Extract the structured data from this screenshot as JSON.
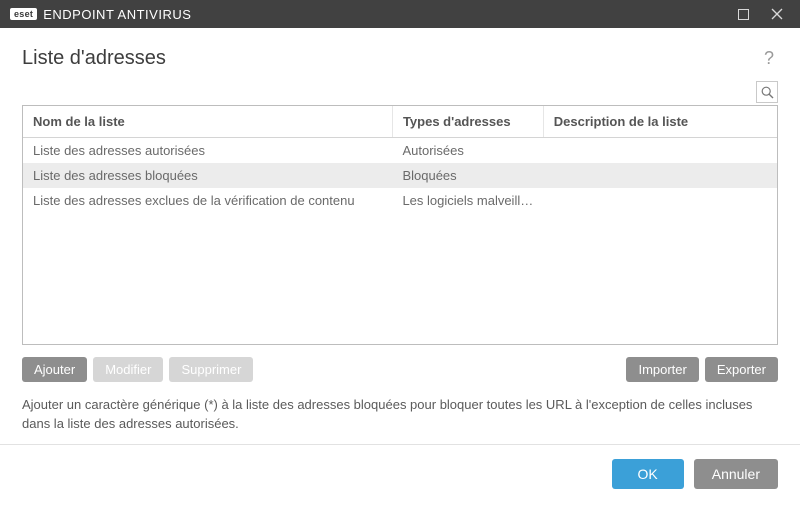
{
  "titlebar": {
    "brand_badge": "eset",
    "product_name": "ENDPOINT ANTIVIRUS"
  },
  "header": {
    "title": "Liste d'adresses",
    "help_tooltip": "?"
  },
  "table": {
    "columns": {
      "name": "Nom de la liste",
      "type": "Types d'adresses",
      "desc": "Description de la liste"
    },
    "rows": [
      {
        "name": "Liste des adresses autorisées",
        "type": "Autorisées",
        "desc": "",
        "selected": false
      },
      {
        "name": "Liste des adresses bloquées",
        "type": "Bloquées",
        "desc": "",
        "selected": true
      },
      {
        "name": "Liste des adresses exclues de la vérification de contenu",
        "type": "Les logiciels malveillants t...",
        "desc": "",
        "selected": false
      }
    ]
  },
  "buttons": {
    "add": "Ajouter",
    "edit": "Modifier",
    "delete": "Supprimer",
    "import": "Importer",
    "export": "Exporter",
    "ok": "OK",
    "cancel": "Annuler"
  },
  "hint": "Ajouter un caractère générique (*) à la liste des adresses bloquées pour bloquer toutes les URL à l'exception de celles incluses dans la liste des adresses autorisées."
}
